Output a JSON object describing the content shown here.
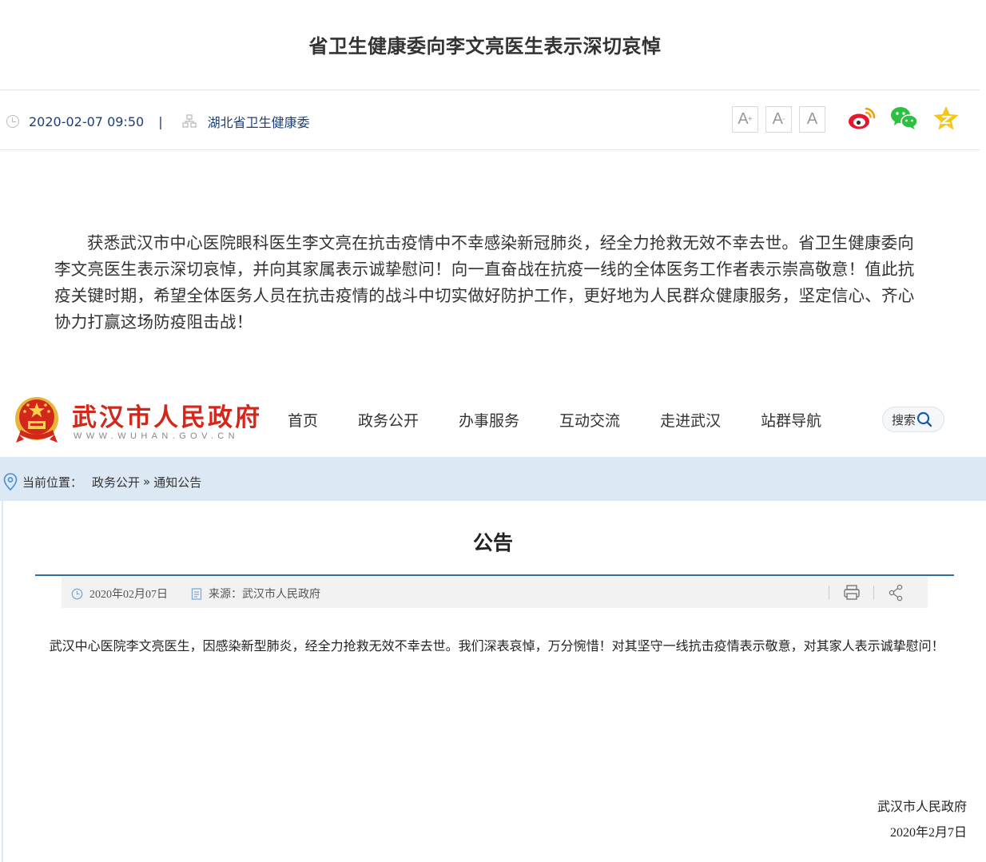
{
  "top_article": {
    "title": "省卫生健康委向李文亮医生表示深切哀悼",
    "datetime": "2020-02-07 09:50",
    "separator": "|",
    "source": "湖北省卫生健康委",
    "font_controls": [
      {
        "glyph": "A",
        "mark": "+"
      },
      {
        "glyph": "A",
        "mark": "-"
      },
      {
        "glyph": "A",
        "mark": ""
      }
    ],
    "body": "获悉武汉市中心医院眼科医生李文亮在抗击疫情中不幸感染新冠肺炎，经全力抢救无效不幸去世。省卫生健康委向李文亮医生表示深切哀悼，并向其家属表示诚挚慰问！向一直奋战在抗疫一线的全体医务工作者表示崇高敬意！值此抗疫关键时期，希望全体医务人员在抗击疫情的战斗中切实做好防护工作，更好地为人民群众健康服务，坚定信心、齐心协力打赢这场防疫阻击战！"
  },
  "wuhan_site": {
    "name": "武汉市人民政府",
    "url": "WWW.WUHAN.GOV.CN",
    "nav": [
      "首页",
      "政务公开",
      "办事服务",
      "互动交流",
      "走进武汉",
      "站群导航"
    ],
    "search_label": "搜索",
    "breadcrumb": {
      "label": "当前位置：",
      "items": [
        "政务公开",
        "通知公告"
      ],
      "sep": "»"
    },
    "notice": {
      "title": "公告",
      "date": "2020年02月07日",
      "source": "来源：武汉市人民政府",
      "body": "武汉中心医院李文亮医生，因感染新型肺炎，经全力抢救无效不幸去世。我们深表哀悼，万分惋惜！对其坚守一线抗击疫情表示敬意，对其家人表示诚挚慰问！",
      "signature_org": "武汉市人民政府",
      "signature_date": "2020年2月7日"
    }
  },
  "colors": {
    "brand_red": "#d4271b",
    "nav_blue": "#1c3f75",
    "breadcrumb_bg": "#dce8f4",
    "rule_blue": "#2d6ea5"
  }
}
